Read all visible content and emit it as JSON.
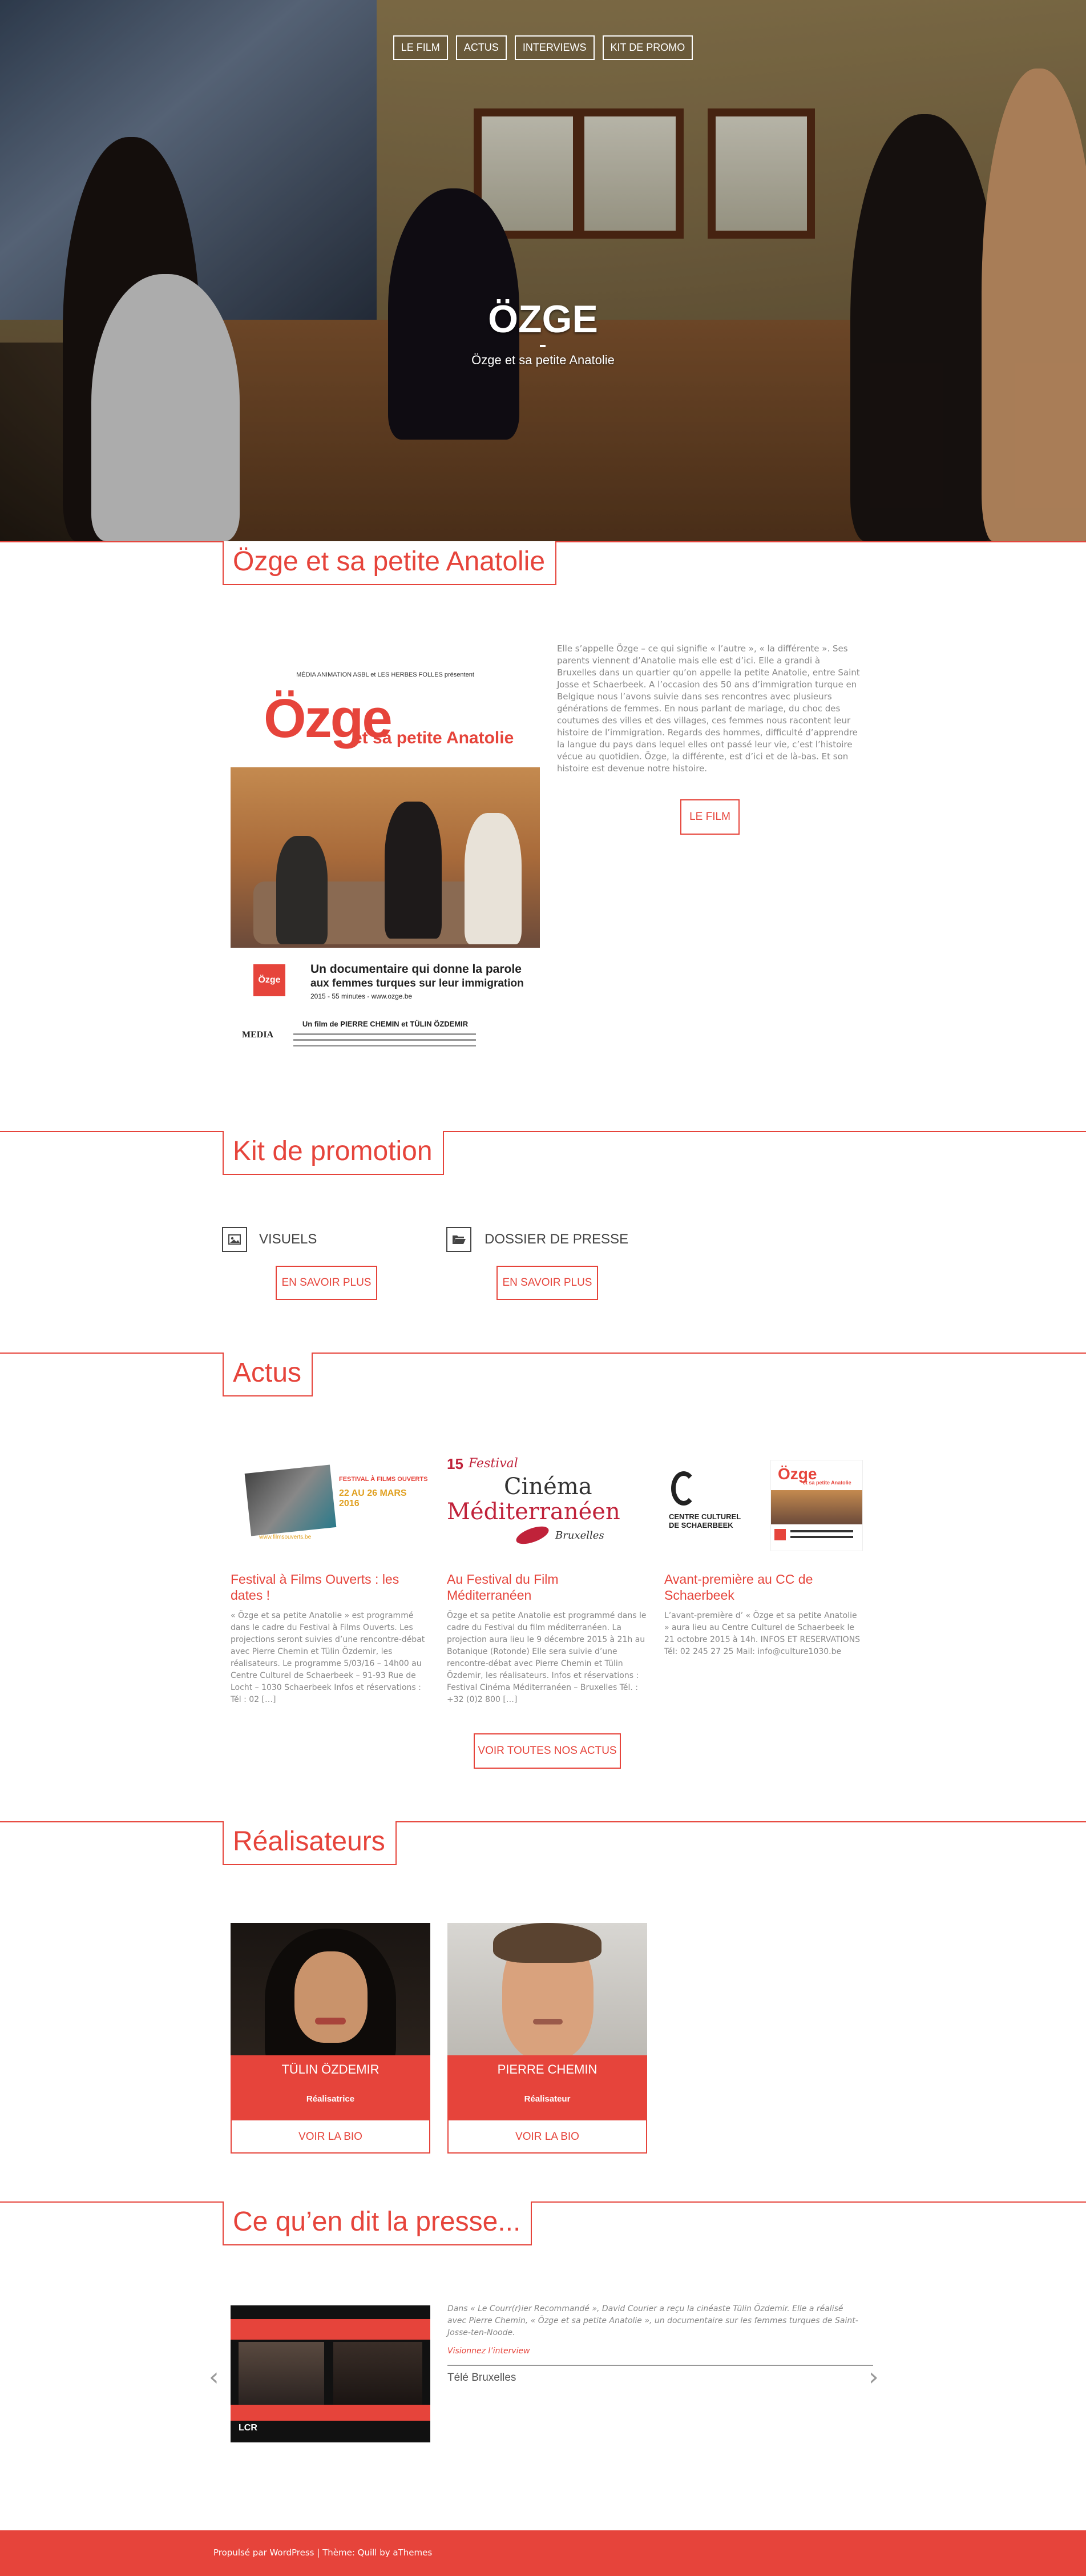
{
  "nav": {
    "items": [
      "LE FILM",
      "ACTUS",
      "INTERVIEWS",
      "KIT DE PROMO"
    ]
  },
  "hero": {
    "title": "ÖZGE",
    "subtitle": "Özge et sa petite Anatolie"
  },
  "intro": {
    "section_title": "Özge et sa petite Anatolie",
    "text": "Elle s’appelle Özge – ce qui signifie « l’autre », « la différente ». Ses parents viennent d’Anatolie mais elle est d’ici. Elle a grandi à Bruxelles dans un quartier qu’on appelle la petite Anatolie, entre Saint Josse et Schaerbeek. A l’occasion des 50 ans d’immigration turque en Belgique nous l’avons suivie dans ses rencontres avec plusieurs générations de femmes. En nous parlant de mariage, du choc des coutumes des villes et des villages, ces femmes nous racontent leur histoire de l’immigration. Regards des hommes, difficulté d’apprendre la langue du pays dans lequel elles ont passé leur vie, c’est l’histoire vécue au quotidien. Özge, la différente, est d’ici et de là-bas. Et son histoire est devenue notre histoire.",
    "button": "LE FILM",
    "poster": {
      "top_line": "MÉDIA ANIMATION ASBL et LES HERBES FOLLES présentent",
      "title_big": "Özge",
      "title_small": "et sa petite Anatolie",
      "badge": "Özge",
      "line1": "Un documentaire qui donne la parole",
      "line2": "aux femmes turques sur leur immigration",
      "line3": "2015 - 55 minutes - www.ozge.be",
      "directors": "Un film de PIERRE CHEMIN et TÜLIN ÖZDEMIR",
      "logo": "MEDIA"
    }
  },
  "kit": {
    "section_title": "Kit de promotion",
    "items": [
      {
        "label": "VISUELS",
        "icon": "image-icon",
        "button": "EN SAVOIR PLUS"
      },
      {
        "label": "DOSSIER DE PRESSE",
        "icon": "folder-open-icon",
        "button": "EN SAVOIR PLUS"
      }
    ]
  },
  "actus": {
    "section_title": "Actus",
    "items": [
      {
        "title": "Festival à Films Ouverts : les dates !",
        "text": "« Özge et sa petite Anatolie » est programmé dans le cadre du Festival à Films Ouverts. Les projections seront suivies d’une rencontre-débat avec Pierre Chemin et Tülin Özdemir, les réalisateurs. Le programme 5/03/16 – 14h00 au Centre Culturel de Schaerbeek – 91-93 Rue de Locht – 1030 Schaerbeek Infos et réservations : Tél : 02 […]",
        "img_caption": "FESTIVAL À FILMS OUVERTS",
        "img_dates": "22 AU 26 MARS 2016",
        "img_url": "www.filmsouverts.be"
      },
      {
        "title": "Au Festival du Film Méditerranéen",
        "text": "Özge et sa petite Anatolie est programmé dans le cadre du Festival du film méditerranéen. La projection aura lieu le 9 décembre 2015 à 21h au Botanique (Rotonde) Elle sera suivie d’une rencontre-débat avec Pierre Chemin et Tülin Özdemir, les réalisateurs. Infos et réservations : Festival Cinéma Méditerranéen – Bruxelles Tél. : +32 (0)2 800 […]",
        "img_festival": "Festival",
        "img_number": "15",
        "img_cinema": "Cinéma",
        "img_med": "Méditerranéen",
        "img_city": "Bruxelles"
      },
      {
        "title": "Avant-première au CC de Schaerbeek",
        "text": "L’avant-première d’ « Özge et sa petite Anatolie » aura lieu au Centre Culturel de Schaerbeek le 21 octobre 2015 à 14h. INFOS ET RESERVATIONS Tél: 02 245 27 25 Mail: info@culture1030.be",
        "img_cc": "CENTRE CULTUREL\nDE SCHAERBEEK",
        "img_title": "Özge",
        "img_sub": "et sa petite Anatolie"
      }
    ],
    "button": "VOIR TOUTES NOS ACTUS"
  },
  "realisateurs": {
    "section_title": "Réalisateurs",
    "items": [
      {
        "name": "TÜLIN ÖZDEMIR",
        "role": "Réalisatrice",
        "button": "VOIR LA BIO"
      },
      {
        "name": "PIERRE CHEMIN",
        "role": "Réalisateur",
        "button": "VOIR LA BIO"
      }
    ]
  },
  "presse": {
    "section_title": "Ce qu’en dit la presse...",
    "quote": "Dans « Le Courr(r)ier Recommandé », David Courier a reçu la cinéaste Tülin Özdemir. Elle a réalisé avec Pierre Chemin, « Özge et sa petite Anatolie », un documentaire sur les femmes turques de Saint-Josse-ten-Noode.",
    "link": "Visionnez l’interview",
    "source": "Télé Bruxelles",
    "img_label": "LCR",
    "prev": "‹",
    "next": "›"
  },
  "footer": {
    "text": "Propulsé par WordPress | Thème: Quill by aThemes"
  },
  "colors": {
    "accent": "#e6443b"
  }
}
